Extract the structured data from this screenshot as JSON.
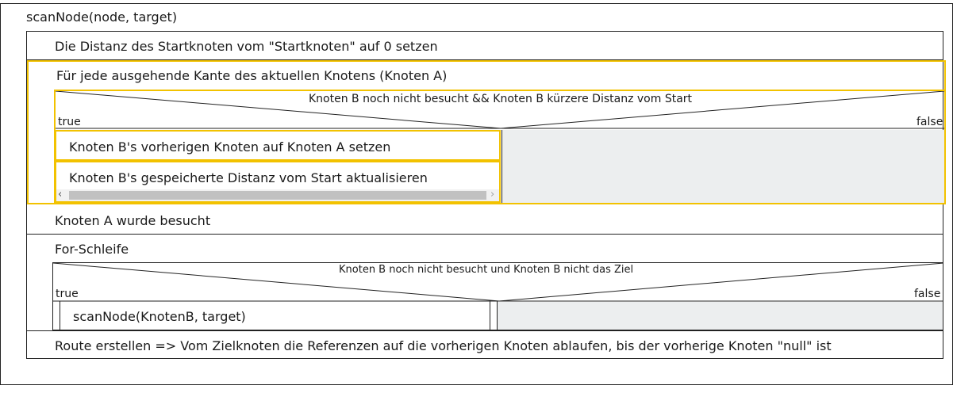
{
  "function": {
    "title": "scanNode(node, target)"
  },
  "steps": {
    "set_start_distance": "Die Distanz des Startknoten vom \"Startknoten\" auf 0 setzen",
    "for_each_edge": "Für jede ausgehende Kante des aktuellen Knotens (Knoten A)",
    "mark_visited": "Knoten A wurde besucht",
    "for_loop": "For-Schleife",
    "build_route": "Route erstellen => Vom Zielknoten die Referenzen auf die vorherigen Knoten ablaufen, bis der vorherige Knoten \"null\" ist"
  },
  "decision1": {
    "condition": "Knoten B noch nicht besucht && Knoten B kürzere Distanz vom Start",
    "true_label": "true",
    "false_label": "false",
    "true_branch": [
      "Knoten B's vorherigen Knoten auf Knoten A setzen",
      "Knoten B's gespeicherte Distanz vom Start aktualisieren"
    ]
  },
  "decision2": {
    "condition": "Knoten B noch nicht besucht und Knoten B nicht das Ziel",
    "true_label": "true",
    "false_label": "false",
    "true_branch": [
      "scanNode(KnotenB, target)"
    ]
  },
  "scrollbar": {
    "left_arrow": "‹",
    "right_arrow": "›"
  },
  "colors": {
    "highlight": "#f2c200",
    "empty_branch": "#eceeef",
    "border": "#222222"
  }
}
